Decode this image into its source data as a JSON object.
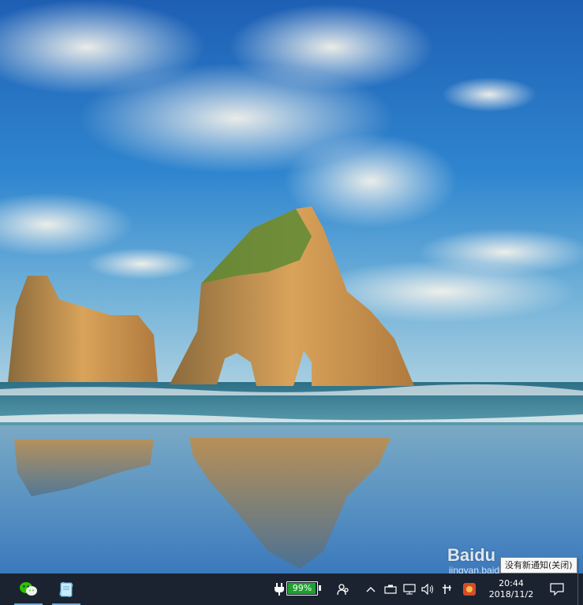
{
  "desktop": {
    "wallpaper": "beach-rocks-sky"
  },
  "taskbar": {
    "apps": [
      {
        "name": "wechat-icon",
        "active": true
      },
      {
        "name": "file-app-icon",
        "active": true
      }
    ],
    "battery": {
      "percent_label": "99%",
      "level": 0.99,
      "color": "#1ea12e"
    },
    "clock": {
      "time": "20:44",
      "date": "2018/11/2"
    }
  },
  "tooltip": {
    "text": "没有新通知(关闭)"
  },
  "watermark": {
    "logo": "Baidu",
    "url": "jingyan.baidu.com"
  }
}
